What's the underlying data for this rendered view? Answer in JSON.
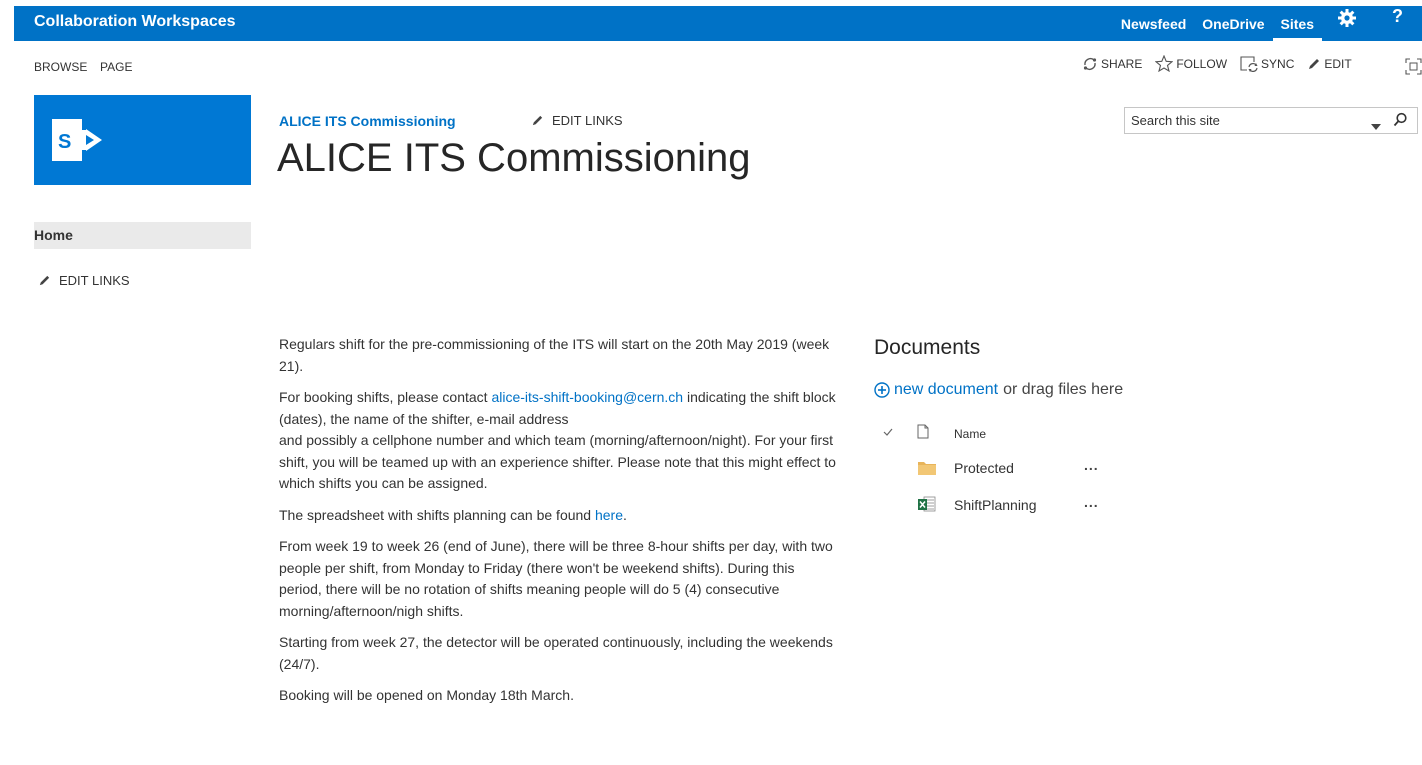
{
  "suite_bar": {
    "title": "Collaboration Workspaces",
    "links": [
      {
        "label": "Newsfeed"
      },
      {
        "label": "OneDrive"
      },
      {
        "label": "Sites",
        "active": true
      }
    ],
    "gear_icon": "gear-icon",
    "help_label": "?",
    "color": "#0072c6"
  },
  "ribbon": {
    "tabs": [
      "BROWSE",
      "PAGE"
    ],
    "actions": [
      {
        "label": "SHARE",
        "icon": "share-icon"
      },
      {
        "label": "FOLLOW",
        "icon": "star-icon"
      },
      {
        "label": "SYNC",
        "icon": "sync-icon"
      },
      {
        "label": "EDIT",
        "icon": "pencil-icon"
      }
    ],
    "focus_icon": "focus-content-icon"
  },
  "header": {
    "logo_icon": "sharepoint-logo-icon",
    "logo_color": "#0078d4",
    "breadcrumb": "ALICE ITS Commissioning",
    "edit_links": "EDIT LINKS",
    "title": "ALICE ITS Commissioning",
    "search_placeholder": "Search this site"
  },
  "quick_launch": {
    "home": "Home",
    "edit_links": "EDIT LINKS"
  },
  "content": {
    "p1": "Regulars shift for the pre-commissioning of the ITS will start on the 20th May 2019 (week 21).",
    "p2_before": "For booking shifts, please contact ",
    "p2_email": "alice-its-shift-booking@cern.ch",
    "p2_after": " indicating the shift block (dates), the name of the shifter, e-mail address",
    "p2_line2": "and possibly a cellphone number and which team (morning/afternoon/night). For your first shift, you will be teamed up with an experience shifter. Please note that this might effect to which shifts you can be assigned.",
    "p3_before": "The spreadsheet with shifts planning can be found ",
    "p3_link": "here",
    "p3_after": ".",
    "p4": "From week 19 to week 26 (end of June), there will be three 8-hour shifts per day, with two people per shift, from Monday to Friday (there won't be weekend shifts). During this period, there will be no rotation of shifts meaning people will do 5 (4) consecutive morning/afternoon/nigh shifts.",
    "p5": "Starting from week 27, the detector will be operated continuously, including the weekends (24/7).",
    "p6": "Booking will be opened on Monday 18th March."
  },
  "documents": {
    "title": "Documents",
    "new_document": "new document",
    "drag_text": "or drag files here",
    "column_name": "Name",
    "items": [
      {
        "name": "Protected",
        "icon": "folder-icon",
        "menu": "..."
      },
      {
        "name": "ShiftPlanning",
        "icon": "excel-file-icon",
        "menu": "..."
      }
    ]
  }
}
